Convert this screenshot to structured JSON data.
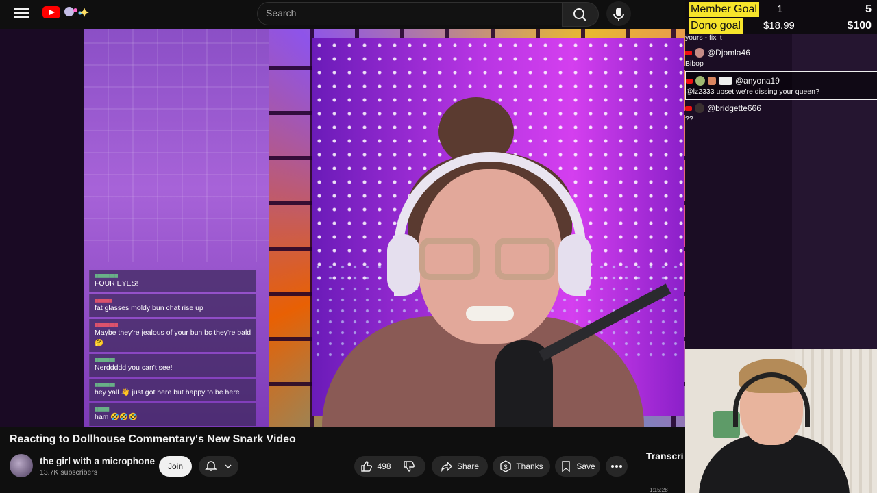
{
  "header": {
    "search_placeholder": "Search",
    "icons": [
      "menu-icon",
      "youtube-logo",
      "search-icon",
      "mic-icon"
    ]
  },
  "stream_goals": {
    "member": {
      "label": "Member Goal",
      "current": "1",
      "target": "5"
    },
    "dono": {
      "label": "Dono goal",
      "current": "$18.99",
      "target": "$100"
    },
    "accent_color": "#f6e42b"
  },
  "live_chat": {
    "truncated_text": "yours - fix it",
    "messages": [
      {
        "user": "@Djomla46",
        "text": "Bibop"
      },
      {
        "user": "@anyona19",
        "text": "@lz2333 upset we're dissing your queen?"
      },
      {
        "user": "@bridgette666",
        "text": "??"
      }
    ]
  },
  "stream_chat": {
    "messages": [
      {
        "text": "FOUR EYES!",
        "user_color": "#6fd08c"
      },
      {
        "text": "fat glasses moldy bun chat rise up",
        "user_color": "#ff5a6a"
      },
      {
        "text": "Maybe they're jealous of your bun bc they're bald 🤔",
        "user_color": "#ff5a6a"
      },
      {
        "text": "Nerddddd you can't see!",
        "user_color": "#6fd08c"
      },
      {
        "text": "hey yall 👋 just got here but happy to be here",
        "user_color": "#6fd08c"
      },
      {
        "text": "ham 🤣🤣🤣",
        "user_color": "#6fd08c"
      }
    ]
  },
  "video": {
    "title": "Reacting to Dollhouse Commentary's New Snark Video",
    "channel": "the girl with a microphone",
    "subscribers": "13.7K subscribers",
    "join_label": "Join",
    "likes": "498",
    "share_label": "Share",
    "thanks_label": "Thanks",
    "save_label": "Save"
  },
  "side_panel": {
    "transcript_label": "Transcri",
    "timestamp": "1:15:28"
  }
}
